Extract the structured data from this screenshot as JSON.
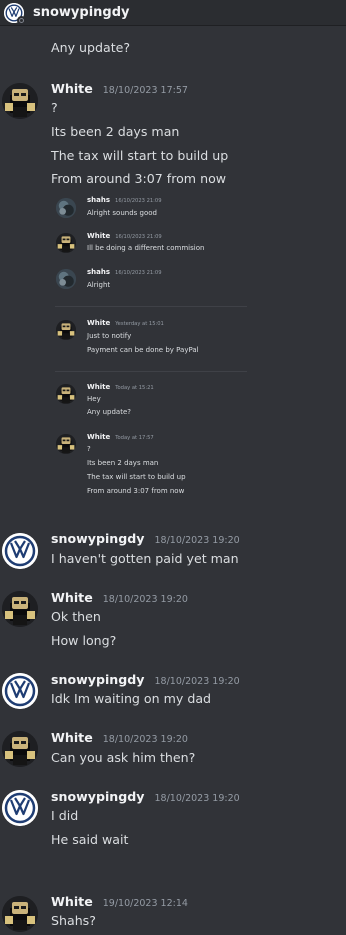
{
  "header": {
    "title": "snowypingdy",
    "avatar_icon": "volkswagen-logo-icon",
    "status_icon": "offline-status-icon"
  },
  "colors": {
    "background": "#313338",
    "header_bg": "#2b2d31",
    "text": "#dbdee1",
    "timestamp": "#949ba4",
    "username": "#f2f3f5"
  },
  "messages": {
    "m0": {
      "lines": [
        "Any update?"
      ]
    },
    "m1": {
      "author": "White",
      "timestamp": "18/10/2023 17:57",
      "lines": [
        "?",
        "Its been 2 days man",
        "The tax will start to build up",
        "From around 3:07 from now"
      ]
    },
    "embed": {
      "e1": {
        "author": "shahs",
        "timestamp": "16/10/2023 21:09",
        "text": "Alright sounds good"
      },
      "e2": {
        "author": "White",
        "timestamp": "16/10/2023 21:09",
        "text": "Ill be doing a different commision"
      },
      "e3": {
        "author": "shahs",
        "timestamp": "16/10/2023 21:09",
        "text": "Alright"
      },
      "e4": {
        "author": "White",
        "timestamp": "Yesterday at 15:01",
        "lines": [
          "Just to notify",
          "Payment can be done by PayPal"
        ]
      },
      "e5": {
        "author": "White",
        "timestamp": "Today at 15:21",
        "lines": [
          "Hey",
          "Any update?"
        ]
      },
      "e6": {
        "author": "White",
        "timestamp": "Today at 17:57",
        "lines": [
          "?",
          "Its been 2 days man",
          "The tax will start to build up",
          "From around 3:07 from now"
        ]
      }
    },
    "m2": {
      "author": "snowypingdy",
      "timestamp": "18/10/2023 19:20",
      "lines": [
        "I haven't gotten paid yet man"
      ]
    },
    "m3": {
      "author": "White",
      "timestamp": "18/10/2023 19:20",
      "lines": [
        "Ok then",
        "How long?"
      ]
    },
    "m4": {
      "author": "snowypingdy",
      "timestamp": "18/10/2023 19:20",
      "lines": [
        "Idk Im waiting on my dad"
      ]
    },
    "m5": {
      "author": "White",
      "timestamp": "18/10/2023 19:20",
      "lines": [
        "Can you ask him then?"
      ]
    },
    "m6": {
      "author": "snowypingdy",
      "timestamp": "18/10/2023 19:20",
      "lines": [
        "I did",
        "He said wait"
      ]
    },
    "m7": {
      "author": "White",
      "timestamp": "19/10/2023 12:14",
      "lines": [
        "Shahs?"
      ]
    }
  }
}
